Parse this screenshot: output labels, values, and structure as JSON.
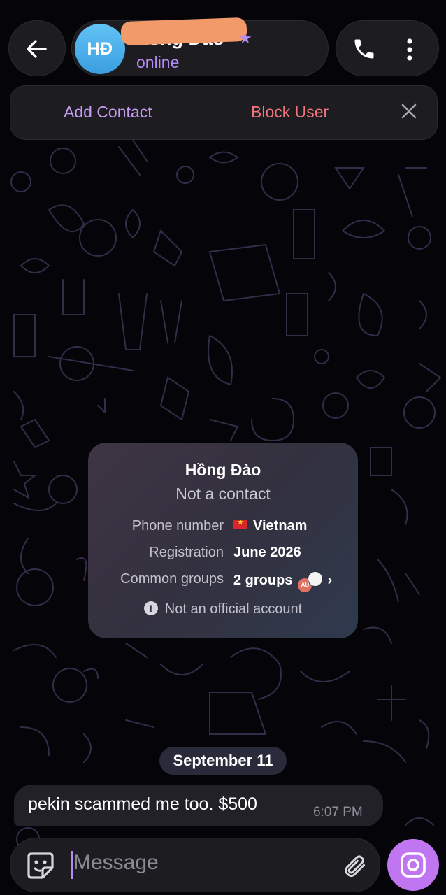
{
  "header": {
    "avatar_initials": "HĐ",
    "contact_name": "Hồng Đào",
    "status": "online"
  },
  "banner": {
    "add_contact_label": "Add Contact",
    "block_user_label": "Block User"
  },
  "info_card": {
    "name": "Hồng Đào",
    "subtitle": "Not a contact",
    "rows": [
      {
        "label": "Phone number",
        "value": "Vietnam"
      },
      {
        "label": "Registration",
        "value": "June 2026"
      },
      {
        "label": "Common groups",
        "value": "2 groups"
      }
    ],
    "group_avatar_text": "AU",
    "note": "Not an official account"
  },
  "date_separator": "September 11",
  "message": {
    "text": "pekin scammed me too. $500",
    "time": "6:07 PM"
  },
  "composer": {
    "placeholder": "Message"
  },
  "colors": {
    "accent": "#b58cf5",
    "block_red": "#f0757c",
    "send_button": "#c076f0"
  }
}
